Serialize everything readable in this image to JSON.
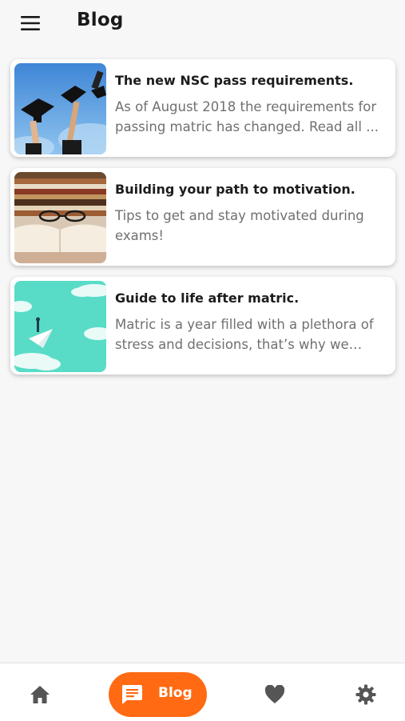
{
  "app_bar": {
    "title": "Blog",
    "menu_icon": "menu-icon"
  },
  "posts": [
    {
      "title": "The new NSC pass requirements.",
      "excerpt": "As of August 2018 the requirements for passing matric has changed. Read all ...",
      "image": "graduation-caps-thrown-in-sky"
    },
    {
      "title": "Building your path to motivation.",
      "excerpt": "Tips to get and stay motivated during exams!",
      "image": "stack-of-books-with-glasses"
    },
    {
      "title": "Guide to life after matric.",
      "excerpt": "Matric is a year filled with a plethora of stress and decisions, that’s why we wan...",
      "image": "person-on-paper-plane-in-clouds"
    }
  ],
  "bottom_nav": {
    "items": [
      {
        "icon": "home-icon",
        "label": ""
      },
      {
        "icon": "chat-icon",
        "label": "Blog",
        "active": true
      },
      {
        "icon": "heart-icon",
        "label": ""
      },
      {
        "icon": "gear-icon",
        "label": ""
      }
    ],
    "accent_color": "#ff6a13",
    "icon_color": "#555555"
  }
}
